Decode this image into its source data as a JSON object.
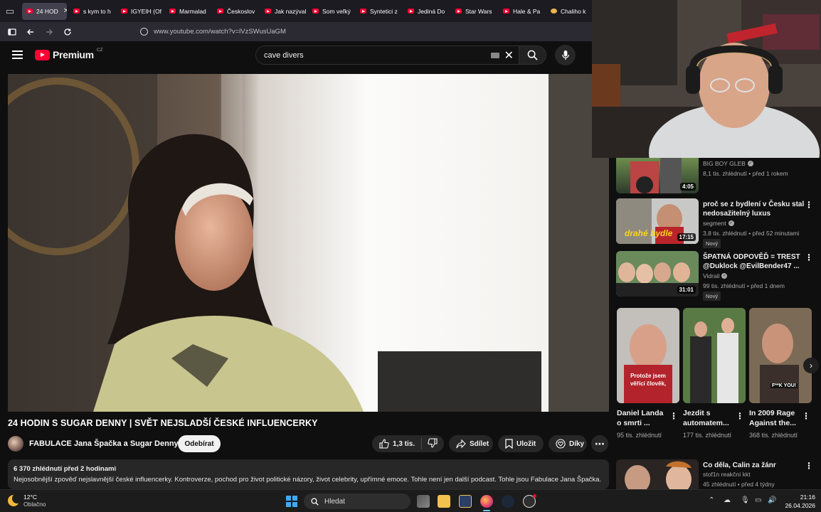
{
  "browser": {
    "tabs": [
      {
        "label": "24 HOD",
        "active": true,
        "icon": "youtube-icon"
      },
      {
        "label": "s kym to h",
        "icon": "youtube-icon"
      },
      {
        "label": "IGYEIH (Of",
        "icon": "youtube-icon"
      },
      {
        "label": "Marmalad",
        "icon": "youtube-icon"
      },
      {
        "label": "Českoslov",
        "icon": "youtube-icon"
      },
      {
        "label": "Jak nazýval",
        "icon": "youtube-icon"
      },
      {
        "label": "Som veľký",
        "icon": "youtube-icon"
      },
      {
        "label": "Syntetici z",
        "icon": "youtube-icon"
      },
      {
        "label": "Jediná Do",
        "icon": "youtube-icon"
      },
      {
        "label": "Star Wars",
        "icon": "youtube-icon"
      },
      {
        "label": "Hale & Pa",
        "icon": "youtube-icon"
      },
      {
        "label": "Chaliho k",
        "icon": "trophy-icon"
      }
    ],
    "url": "www.youtube.com/watch?v=lVzSWusUaGM"
  },
  "youtube": {
    "logo_text": "Premium",
    "logo_country": "CZ",
    "search_value": "cave divers"
  },
  "video": {
    "title": "24 HODIN S SUGAR DENNY | SVĚT NEJSLADŠÍ ČESKÉ INFLUENCERKY",
    "channel": "FABULACE Jana Špačka a Sugar Denny",
    "subscribe_label": "Odebírat",
    "likes": "1,3 tis.",
    "share_label": "Sdílet",
    "save_label": "Uložit",
    "thanks_label": "Díky",
    "views_date": "6 370 zhlédnutí  před 2 hodinami",
    "description": "Nejosobnější zpověď nejslavnější české influencerky. Kontroverze, pochod pro život politické názory, život celebrity, upřímné emoce. Tohle není jen další podcast. Tohle jsou Fabulace Jana Špačka."
  },
  "sidebar": {
    "videos": [
      {
        "title": "",
        "channel": "BIG BOY GLEB",
        "meta": "8,1 tis. zhlédnutí • před 1 rokem",
        "duration": "4:05",
        "new": ""
      },
      {
        "title": "proč se z bydlení v Česku stal nedosažitelný luxus",
        "channel": "segment",
        "meta": "3,8 tis. zhlédnutí • před 52 minutami",
        "duration": "17:15",
        "new": "Nový",
        "thumb_text": "drahé bydle"
      },
      {
        "title": "ŠPATNÁ ODPOVĚĎ = TREST @Duklock @EvilBender47 ...",
        "channel": "Vidrail",
        "meta": "99 tis. zhlédnutí • před 1 dnem",
        "duration": "31:01",
        "new": "Nový"
      }
    ],
    "shorts": [
      {
        "title": "Daniel Landa o smrti ...",
        "views": "95 tis. zhlédnutí",
        "caption": "Protože jsem věřící člověk,"
      },
      {
        "title": "Jezdit s automatem...",
        "views": "177 tis. zhlédnutí",
        "caption": ""
      },
      {
        "title": "In 2009 Rage Against the...",
        "views": "368 tis. zhlédnutí",
        "caption": "F**K YOU!"
      }
    ],
    "last": {
      "title": "Co děla, Calin za žánr",
      "channel": "stof1n reakční kkt",
      "meta": "45 zhlédnutí • před 4 týdny"
    }
  },
  "taskbar": {
    "temp": "12°C",
    "weather": "Oblačno",
    "search_label": "Hledat",
    "time": "21:16",
    "date": "26.04.2026"
  },
  "colors": {
    "yt_red": "#ff0033",
    "bg": "#0f0f0f",
    "pill": "#272727"
  }
}
